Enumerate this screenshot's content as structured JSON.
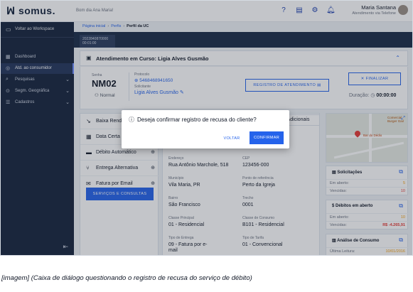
{
  "header": {
    "logo": "ꟽ somus.",
    "greeting": "Bom dia Ana Maria!",
    "user_name": "Maria Santana",
    "user_role": "Atendimento via Telefone",
    "icons": [
      "help-icon",
      "news-icon",
      "settings-icon",
      "bell-icon"
    ]
  },
  "sidebar": {
    "back": "Voltar ao Workspace",
    "items": [
      {
        "label": "Dashboard",
        "icon": "dashboard-icon"
      },
      {
        "label": "Atd. ao consumidor",
        "icon": "headset-icon"
      },
      {
        "label": "Pesquisas",
        "icon": "search-icon"
      },
      {
        "label": "Segm. Geográfica",
        "icon": "location-icon"
      },
      {
        "label": "Cadastros",
        "icon": "list-icon"
      }
    ]
  },
  "breadcrumb": {
    "a": "Página inicial",
    "b": "Perfis",
    "c": "Perfil da UC"
  },
  "tab": {
    "line1": "2022840870000",
    "line2": "00:01:00"
  },
  "attend": {
    "title": "Atendimento em Curso: Ligia Alves Gusmão",
    "senha_label": "Senha",
    "senha_value": "NM02",
    "senha_type": "Normal",
    "protocolo_label": "Protocolo",
    "protocolo_value": "5468468941650",
    "solicitante_label": "Solicitante",
    "solicitante_value": "Ligia Alves Gusmão",
    "registro_button": "REGISTRO DE ATENDIMENTO",
    "finalizar_button": "FINALIZAR",
    "duracao_label": "Duração:",
    "duracao_value": "00:00:00"
  },
  "menu": {
    "items": [
      "Baixa Renda",
      "Data Certa",
      "Débito Automático",
      "Entrega Alternativa",
      "Fatura por Email"
    ],
    "services_button": "SERVIÇOS E CONSULTAS"
  },
  "center": {
    "tab_adicionais": "s Adicionais",
    "endereco_label": "Endereço",
    "endereco_value": "Rua Antônio Marchole, 518",
    "cep_label": "CEP",
    "cep_value": "123456-000",
    "municipio_label": "Município",
    "municipio_value": "Vila Maria, PR",
    "referencia_label": "Ponto de referência",
    "referencia_value": "Perto da Igreja",
    "bairro_label": "Bairro",
    "bairro_value": "São Francisco",
    "trecho_label": "Trecho",
    "trecho_value": "0001",
    "classe_label": "Classe Principal",
    "classe_value": "01 - Residencial",
    "classe_consumo_label": "Classe de Consumo",
    "classe_consumo_value": "B101 - Residencial",
    "entrega_label": "Tipo de Entrega",
    "entrega_value": "09 - Fatura por e-mail",
    "tarifa_label": "Tipo de Tarifa",
    "tarifa_value": "01 - Convencional"
  },
  "map": {
    "label1": "Comercial Burger Gail",
    "label2": "Bar do Dédio"
  },
  "solicitacoes": {
    "title": "Solicitações",
    "rows": [
      {
        "k": "Em aberto:",
        "v": "5"
      },
      {
        "k": "Vencidas:",
        "v": "10"
      }
    ]
  },
  "debitos": {
    "title": "Débitos em aberto",
    "rows": [
      {
        "k": "Em aberto:",
        "v": "10"
      },
      {
        "k": "Vencidas:",
        "v": "R$ -4.265,91"
      }
    ]
  },
  "consumo": {
    "title": "Análise de Consumo",
    "rows": [
      {
        "k": "Última Leitura:",
        "v": "10/01/2016"
      }
    ]
  },
  "dialog": {
    "message": "Deseja confirmar registro de recusa do cliente?",
    "cancel": "VOLTAR",
    "confirm": "CONFIRMAR"
  },
  "caption": "[imagem] (Caixa de diálogo questionando o registro de recusa do serviço de débito)",
  "colors": {
    "primary": "#2563eb",
    "sidebar": "#15233c",
    "danger": "#e53935",
    "warning": "#f59e0b"
  }
}
